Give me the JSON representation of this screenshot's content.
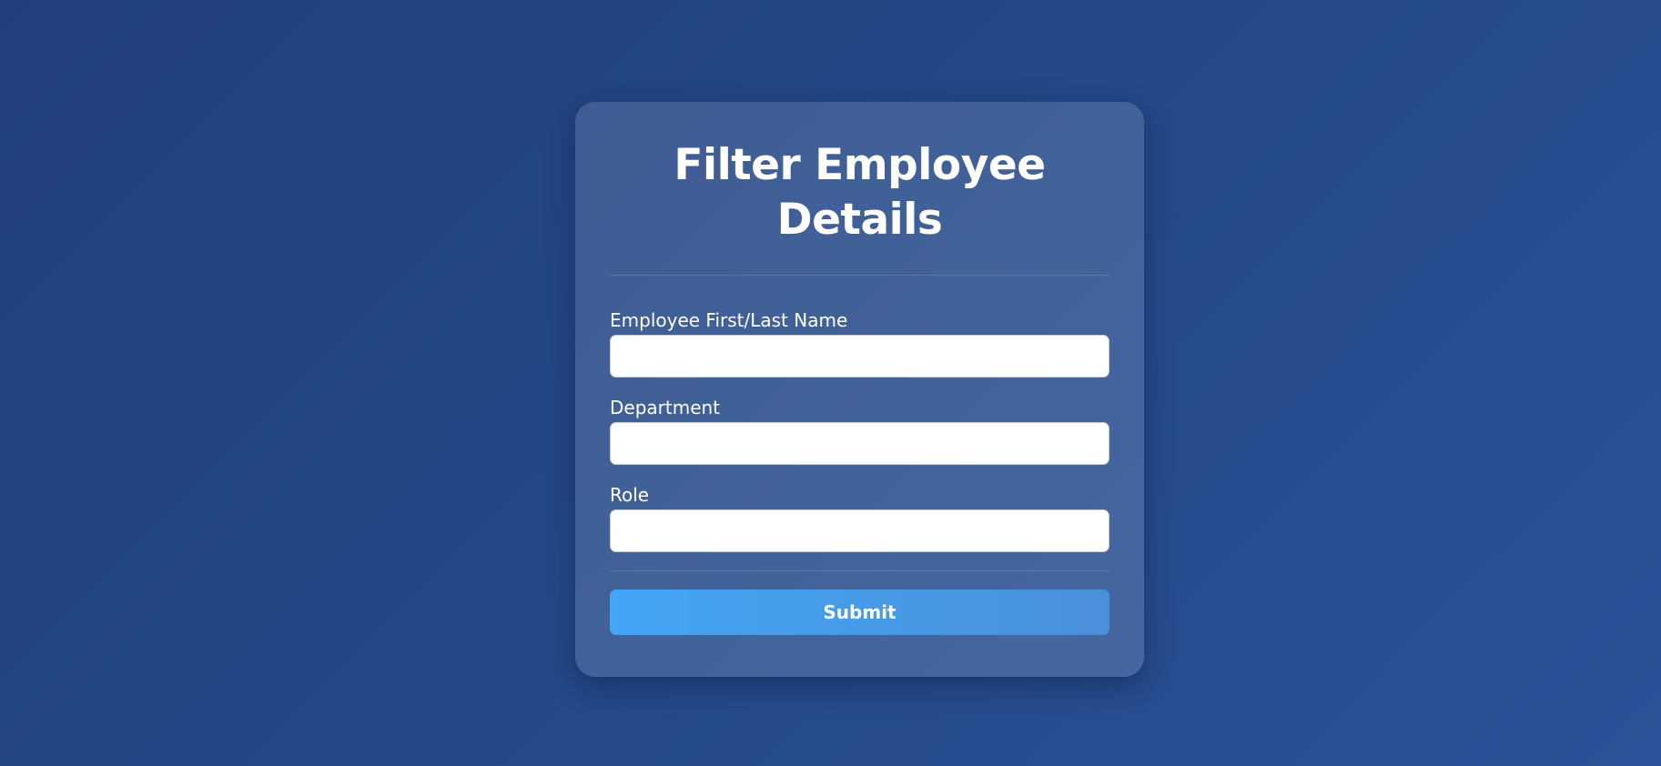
{
  "form": {
    "title_line1": "Filter Employee",
    "title_line2": "Details",
    "fields": [
      {
        "label": "Employee First/Last Name",
        "value": "",
        "placeholder": ""
      },
      {
        "label": "Department",
        "value": "",
        "placeholder": ""
      },
      {
        "label": "Role",
        "value": "",
        "placeholder": ""
      }
    ],
    "submit_label": "Submit"
  },
  "colors": {
    "background": "#244a8a",
    "button_start": "#42a5f5",
    "button_end": "#4a90d9"
  }
}
